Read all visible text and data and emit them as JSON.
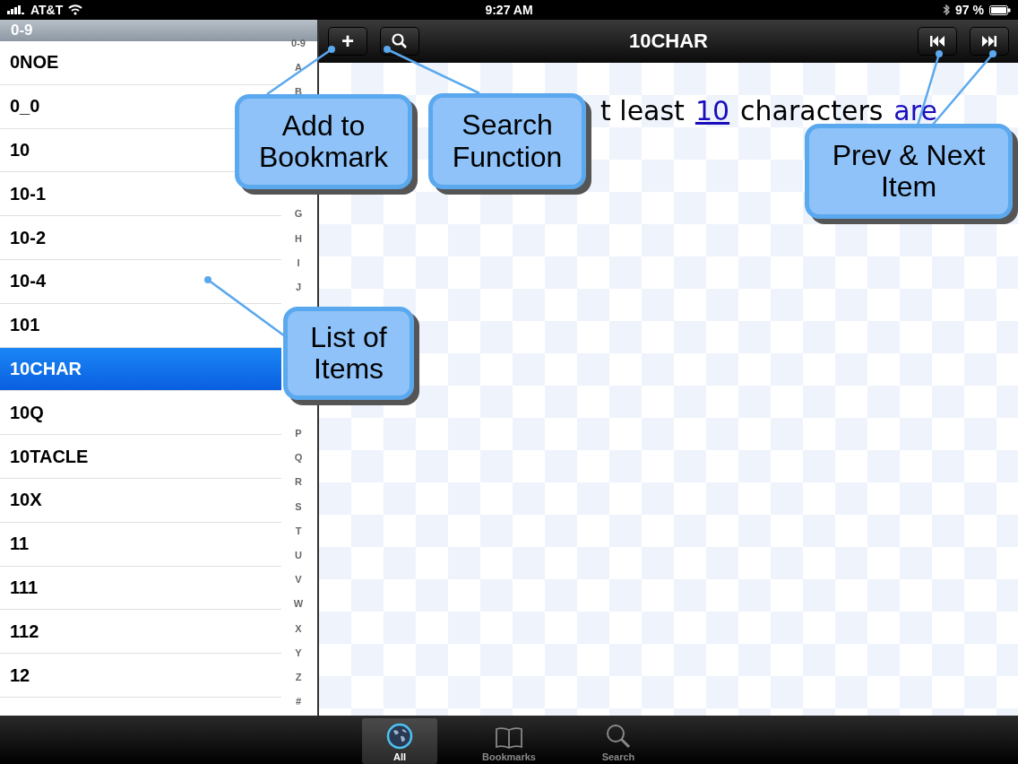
{
  "status_bar": {
    "carrier": "AT&T",
    "time": "9:27 AM",
    "battery": "97 %"
  },
  "list": {
    "section": "0-9",
    "items": [
      {
        "label": "0NOE",
        "selected": false
      },
      {
        "label": "0_0",
        "selected": false
      },
      {
        "label": "10",
        "selected": false
      },
      {
        "label": "10-1",
        "selected": false
      },
      {
        "label": "10-2",
        "selected": false
      },
      {
        "label": "10-4",
        "selected": false
      },
      {
        "label": "101",
        "selected": false
      },
      {
        "label": "10CHAR",
        "selected": true
      },
      {
        "label": "10Q",
        "selected": false
      },
      {
        "label": "10TACLE",
        "selected": false
      },
      {
        "label": "10X",
        "selected": false
      },
      {
        "label": "11",
        "selected": false
      },
      {
        "label": "111",
        "selected": false
      },
      {
        "label": "112",
        "selected": false
      },
      {
        "label": "12",
        "selected": false
      }
    ],
    "index": [
      "0-9",
      "A",
      "B",
      "G",
      "H",
      "I",
      "J",
      "P",
      "Q",
      "R",
      "S",
      "T",
      "U",
      "V",
      "W",
      "X",
      "Y",
      "Z",
      "#"
    ]
  },
  "nav_bar": {
    "title": "10CHAR",
    "left_buttons": [
      "+"
    ]
  },
  "content": {
    "parts": [
      {
        "kind": "text",
        "text": "t least"
      },
      {
        "kind": "link",
        "text": "10"
      },
      {
        "kind": "text",
        "text": "characters"
      },
      {
        "kind": "link",
        "text": "are"
      }
    ]
  },
  "callouts": [
    {
      "kind": "bookmark",
      "text": "Add to Bookmark"
    },
    {
      "kind": "search",
      "text": "Search Function"
    },
    {
      "kind": "prevnext",
      "text": "Prev & Next Item"
    },
    {
      "kind": "list",
      "text": "List of Items"
    }
  ],
  "tab_bar": [
    {
      "label": "All",
      "selected": true
    },
    {
      "label": "Bookmarks",
      "selected": false
    },
    {
      "label": "Search",
      "selected": false
    }
  ]
}
